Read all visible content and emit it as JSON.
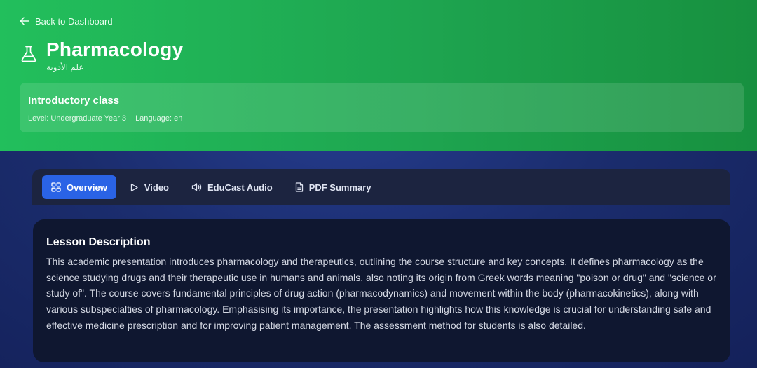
{
  "header": {
    "back_label": "Back to Dashboard",
    "title": "Pharmacology",
    "arabic_title": "علم الأدوية",
    "icon": "flask-icon"
  },
  "class_card": {
    "title": "Introductory class",
    "level": "Level: Undergraduate Year 3",
    "language": "Language: en"
  },
  "tabs": [
    {
      "label": "Overview",
      "icon": "grid-icon",
      "active": true
    },
    {
      "label": "Video",
      "icon": "play-icon",
      "active": false
    },
    {
      "label": "EduCast Audio",
      "icon": "speaker-icon",
      "active": false
    },
    {
      "label": "PDF Summary",
      "icon": "document-icon",
      "active": false
    }
  ],
  "lesson": {
    "heading": "Lesson Description",
    "description": "This academic presentation introduces pharmacology and therapeutics, outlining the course structure and key concepts. It defines pharmacology as the science studying drugs and their therapeutic use in humans and animals, also noting its origin from Greek words meaning \"poison or drug\" and \"science or study of\". The course covers fundamental principles of drug action (pharmacodynamics) and movement within the body (pharmacokinetics), along with various subspecialties of pharmacology. Emphasising its importance, the presentation highlights how this knowledge is crucial for understanding safe and effective medicine prescription and for improving patient management. The assessment method for students is also detailed."
  },
  "colors": {
    "hero_green": "#1ea550",
    "active_tab": "#2a63e6",
    "tab_bar": "#1c2440",
    "card_bg": "#0f1730"
  }
}
